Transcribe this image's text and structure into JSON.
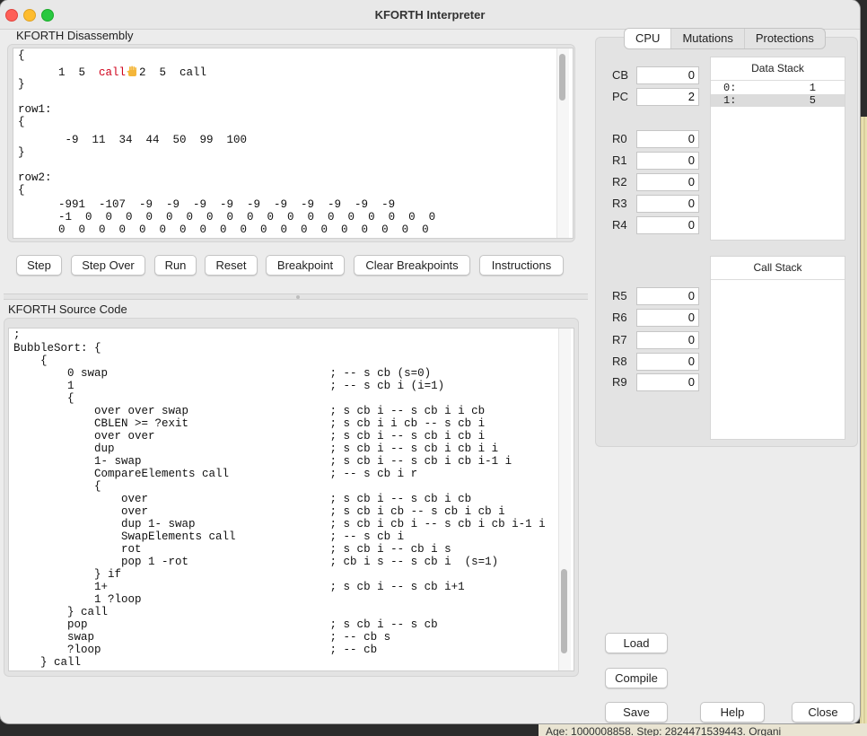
{
  "window": {
    "title": "KFORTH Interpreter"
  },
  "disassembly": {
    "label": "KFORTH Disassembly",
    "lines": [
      "{",
      "      1  5  ",
      "}",
      "",
      "row1:",
      "{",
      "       -9  11  34  44  50  99  100",
      "}",
      "",
      "row2:",
      "{",
      "      -991  -107  -9  -9  -9  -9  -9  -9  -9  -9  -9  -9",
      "      -1  0  0  0  0  0  0  0  0  0  0  0  0  0  0  0  0  0  0",
      "      0  0  0  0  0  0  0  0  0  0  0  0  0  0  0  0  0  0  0"
    ],
    "current_token": "call",
    "current_color": "#d0021b",
    "breakpoint_icon": "hand-icon",
    "after_break": "2  5  call"
  },
  "controls": {
    "step": "Step",
    "step_over": "Step Over",
    "run": "Run",
    "reset": "Reset",
    "breakpoint": "Breakpoint",
    "clear_breakpoints": "Clear Breakpoints",
    "instructions": "Instructions"
  },
  "source": {
    "label": "KFORTH Source Code",
    "lines": [
      ";",
      "BubbleSort: {",
      "    {",
      "        0 swap                                 ; -- s cb (s=0)",
      "        1                                      ; -- s cb i (i=1)",
      "        {",
      "            over over swap                     ; s cb i -- s cb i i cb",
      "            CBLEN >= ?exit                     ; s cb i i cb -- s cb i",
      "            over over                          ; s cb i -- s cb i cb i",
      "            dup                                ; s cb i -- s cb i cb i i",
      "            1- swap                            ; s cb i -- s cb i cb i-1 i",
      "            CompareElements call               ; -- s cb i r",
      "            {",
      "                over                           ; s cb i -- s cb i cb",
      "                over                           ; s cb i cb -- s cb i cb i",
      "                dup 1- swap                    ; s cb i cb i -- s cb i cb i-1 i",
      "                SwapElements call              ; -- s cb i",
      "                rot                            ; s cb i -- cb i s",
      "                pop 1 -rot                     ; cb i s -- s cb i  (s=1)",
      "            } if",
      "            1+                                 ; s cb i -- s cb i+1",
      "            1 ?loop",
      "        } call",
      "        pop                                    ; s cb i -- s cb",
      "        swap                                   ; -- cb s",
      "        ?loop                                  ; -- cb",
      "    } call"
    ]
  },
  "tabs": [
    {
      "label": "CPU",
      "selected": true
    },
    {
      "label": "Mutations",
      "selected": false
    },
    {
      "label": "Protections",
      "selected": false
    }
  ],
  "registers": {
    "CB": "0",
    "PC": "2",
    "R0": "0",
    "R1": "0",
    "R2": "0",
    "R3": "0",
    "R4": "0",
    "R5": "0",
    "R6": "0",
    "R7": "0",
    "R8": "0",
    "R9": "0"
  },
  "data_stack": {
    "title": "Data Stack",
    "rows": [
      {
        "index": "0:",
        "value": "1"
      },
      {
        "index": "1:",
        "value": "5"
      }
    ]
  },
  "call_stack": {
    "title": "Call Stack"
  },
  "buttons": {
    "load": "Load",
    "compile": "Compile",
    "save": "Save",
    "help": "Help",
    "close": "Close"
  },
  "background": {
    "status_text": "Age: 1000008858. Step: 2824471539443. Organi"
  }
}
